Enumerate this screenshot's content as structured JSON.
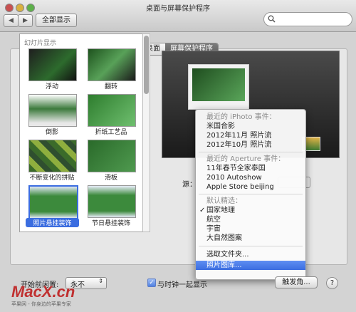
{
  "window": {
    "title": "桌面与屏幕保护程序"
  },
  "toolbar": {
    "back": "◀",
    "forward": "▶",
    "show_all": "全部显示",
    "search_value": ""
  },
  "tabs": [
    {
      "label": "桌面",
      "selected": false
    },
    {
      "label": "屏幕保护程序",
      "selected": true
    }
  ],
  "slides": {
    "header": "幻灯片显示",
    "items": [
      {
        "label": "浮动"
      },
      {
        "label": "翻转"
      },
      {
        "label": "倒影"
      },
      {
        "label": "折纸工艺品"
      },
      {
        "label": "不断变化的拼贴"
      },
      {
        "label": "滑板"
      },
      {
        "label": "照片悬挂装饰",
        "selected": true
      },
      {
        "label": "节日悬挂装饰"
      }
    ]
  },
  "source": {
    "label": "源：",
    "menu": {
      "iphoto_header": "最近的 iPhoto 事件：",
      "iphoto_items": [
        "米国合影",
        "2012年11月 照片流",
        "2012年10月 照片流"
      ],
      "aperture_header": "最近的 Aperture 事件：",
      "aperture_items": [
        "11年春节全家泰国",
        "2010 Autoshow",
        "Apple Store beijing"
      ],
      "default_header": "默认精选：",
      "default_items": [
        "国家地理",
        "航空",
        "宇宙",
        "大自然图案"
      ],
      "checked_item": "国家地理",
      "choose_folder": "选取文件夹...",
      "photo_library": "照片图库..."
    }
  },
  "bottom": {
    "start_label": "开始前闲置:",
    "start_value": "永不",
    "clock_label": "与时钟一起显示",
    "clock_checked": true,
    "hot_corners": "触发角...",
    "help": "?"
  },
  "watermark": {
    "logo": "MacX.cn",
    "tagline": "苹果网 - 你身边的苹果专家"
  },
  "colors": {
    "highlight": "#3b6de0",
    "accent_watermark": "#c03030"
  }
}
